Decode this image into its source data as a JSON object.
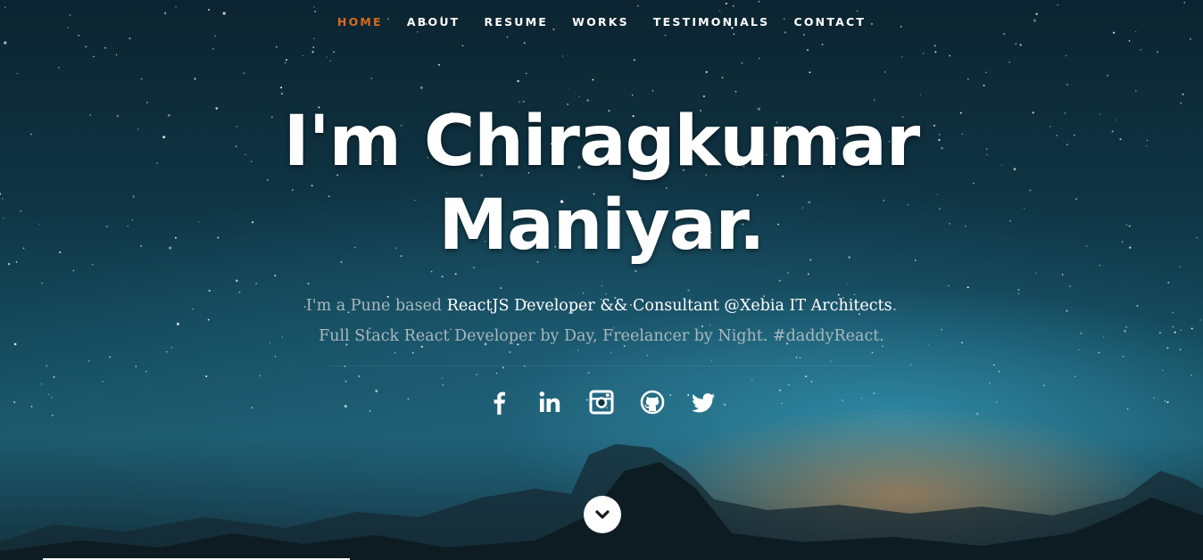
{
  "nav": {
    "items": [
      {
        "label": "HOME",
        "active": true
      },
      {
        "label": "ABOUT",
        "active": false
      },
      {
        "label": "RESUME",
        "active": false
      },
      {
        "label": "WORKS",
        "active": false
      },
      {
        "label": "TESTIMONIALS",
        "active": false
      },
      {
        "label": "CONTACT",
        "active": false
      }
    ]
  },
  "hero": {
    "headline_line1": "I'm Chiragkumar",
    "headline_line2": "Maniyar.",
    "intro_line1_prefix": "I'm a Pune based ",
    "intro_line1_highlight": "ReactJS Developer && Consultant @Xebia IT Architects",
    "intro_line1_suffix": ".",
    "intro_line2": "Full Stack React Developer by Day, Freelancer by Night. #daddyReact."
  },
  "social": {
    "icons": [
      "facebook-icon",
      "linkedin-icon",
      "instagram-icon",
      "github-icon",
      "twitter-icon"
    ]
  },
  "scroll_down": {
    "icon": "chevron-down-icon"
  },
  "colors": {
    "accent": "#d86b1e",
    "text": "#ffffff",
    "muted": "#a9b9bd"
  }
}
